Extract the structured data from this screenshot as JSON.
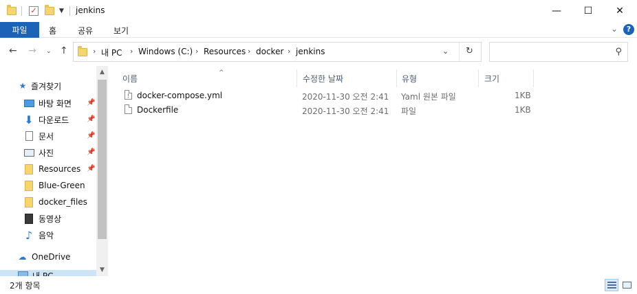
{
  "window": {
    "title": "jenkins",
    "minimize_glyph": "—",
    "maximize_glyph": "☐",
    "close_glyph": "✕"
  },
  "ribbon": {
    "tabs": [
      "파일",
      "홈",
      "공유",
      "보기"
    ],
    "help_glyph": "?"
  },
  "address": {
    "crumbs": [
      "내 PC",
      "Windows (C:)",
      "Resources",
      "docker",
      "jenkins"
    ],
    "search_placeholder": ""
  },
  "nav": {
    "quick_access_label": "즐겨찾기",
    "items": [
      {
        "label": "바탕 화면",
        "icon": "desktop-icon",
        "pinned": true
      },
      {
        "label": "다운로드",
        "icon": "download-icon",
        "pinned": true
      },
      {
        "label": "문서",
        "icon": "document-icon",
        "pinned": true
      },
      {
        "label": "사진",
        "icon": "pictures-icon",
        "pinned": true
      },
      {
        "label": "Resources",
        "icon": "folder-icon",
        "pinned": true
      },
      {
        "label": "Blue-Green",
        "icon": "folder-icon",
        "pinned": false
      },
      {
        "label": "docker_files",
        "icon": "folder-icon",
        "pinned": false
      },
      {
        "label": "동영상",
        "icon": "video-icon",
        "pinned": false
      },
      {
        "label": "음악",
        "icon": "music-icon",
        "pinned": false
      }
    ],
    "onedrive_label": "OneDrive",
    "thispc_label": "내 PC"
  },
  "columns": {
    "name": "이름",
    "date": "수정한 날짜",
    "type": "유형",
    "size": "크기"
  },
  "files": [
    {
      "name": "docker-compose.yml",
      "date": "2020-11-30 오전 2:41",
      "type": "Yaml 원본 파일",
      "size": "1KB",
      "icon": "yaml-file-icon"
    },
    {
      "name": "Dockerfile",
      "date": "2020-11-30 오전 2:41",
      "type": "파일",
      "size": "1KB",
      "icon": "file-icon"
    }
  ],
  "status": {
    "item_count": "2개 항목"
  },
  "colors": {
    "accent": "#1a63b8",
    "selection": "#cce4f7",
    "folder": "#f5d56e"
  }
}
